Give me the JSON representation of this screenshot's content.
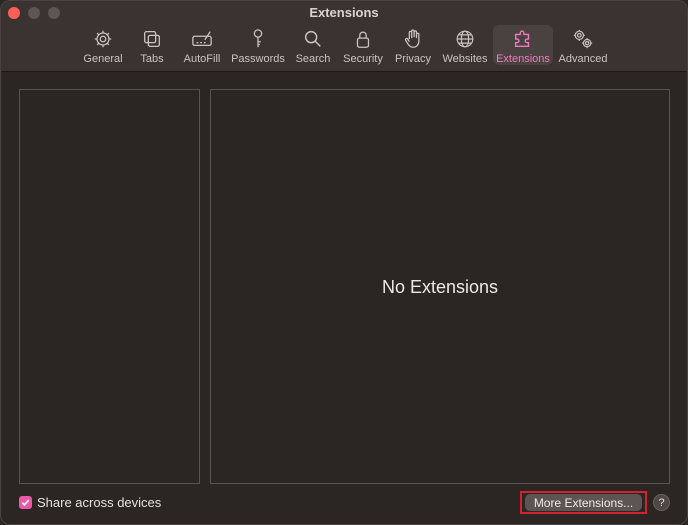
{
  "window": {
    "title": "Extensions"
  },
  "tabs": [
    {
      "label": "General",
      "icon": "gear-icon"
    },
    {
      "label": "Tabs",
      "icon": "tabs-icon"
    },
    {
      "label": "AutoFill",
      "icon": "autofill-icon"
    },
    {
      "label": "Passwords",
      "icon": "key-icon"
    },
    {
      "label": "Search",
      "icon": "search-icon"
    },
    {
      "label": "Security",
      "icon": "lock-icon"
    },
    {
      "label": "Privacy",
      "icon": "hand-icon"
    },
    {
      "label": "Websites",
      "icon": "globe-icon"
    },
    {
      "label": "Extensions",
      "icon": "puzzle-icon",
      "active": true
    },
    {
      "label": "Advanced",
      "icon": "gears-icon"
    }
  ],
  "main": {
    "empty_message": "No Extensions"
  },
  "footer": {
    "share_label": "Share across devices",
    "share_checked": true,
    "more_button": "More Extensions...",
    "help": "?"
  },
  "colors": {
    "accent": "#e85aa6",
    "highlight_outline": "#d1222d"
  }
}
